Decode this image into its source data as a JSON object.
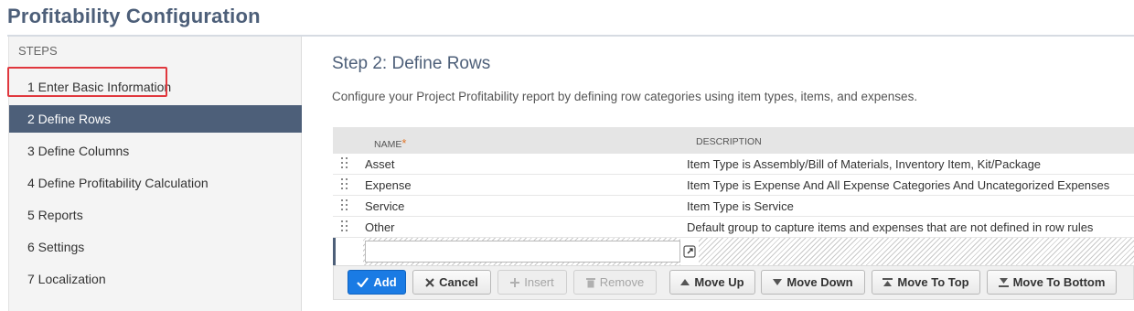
{
  "page": {
    "title": "Profitability Configuration"
  },
  "sidebar": {
    "heading": "STEPS",
    "steps": [
      {
        "label": "1 Enter Basic Information",
        "active": false
      },
      {
        "label": "2 Define Rows",
        "active": true
      },
      {
        "label": "3 Define Columns",
        "active": false
      },
      {
        "label": "4 Define Profitability Calculation",
        "active": false
      },
      {
        "label": "5 Reports",
        "active": false
      },
      {
        "label": "6 Settings",
        "active": false
      },
      {
        "label": "7 Localization",
        "active": false
      }
    ]
  },
  "main": {
    "title": "Step 2: Define Rows",
    "description": "Configure your Project Profitability report by defining row categories using item types, items, and expenses."
  },
  "grid": {
    "columns": {
      "name": "NAME",
      "required_mark": "*",
      "description": "DESCRIPTION"
    },
    "rows": [
      {
        "name": "Asset",
        "description": "Item Type is Assembly/Bill of Materials, Inventory Item, Kit/Package"
      },
      {
        "name": "Expense",
        "description": "Item Type is Expense And All Expense Categories And Uncategorized Expenses"
      },
      {
        "name": "Service",
        "description": "Item Type is Service"
      },
      {
        "name": "Other",
        "description": "Default group to capture items and expenses that are not defined in row rules"
      }
    ],
    "edit_row": {
      "name_value": ""
    }
  },
  "buttons": {
    "add": "Add",
    "cancel": "Cancel",
    "insert": "Insert",
    "remove": "Remove",
    "move_up": "Move Up",
    "move_down": "Move Down",
    "move_to_top": "Move To Top",
    "move_to_bottom": "Move To Bottom"
  },
  "colors": {
    "accent": "#4d5f79",
    "primary_button": "#1a7be4",
    "highlight_outline": "#e0383e",
    "required_mark": "#e0762b"
  }
}
